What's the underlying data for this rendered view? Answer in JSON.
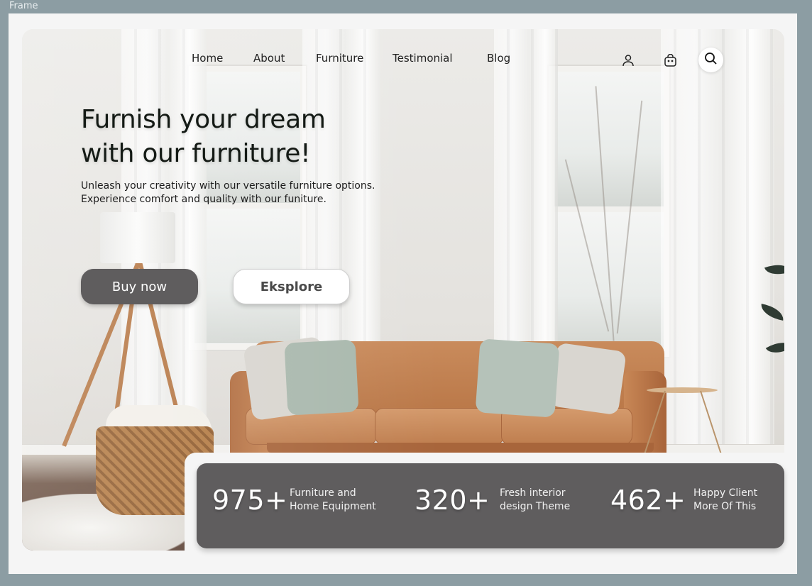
{
  "canvas": {
    "frame_label": "Frame"
  },
  "nav": {
    "links": [
      "Home",
      "About",
      "Furniture",
      "Testimonial",
      "Blog"
    ],
    "icons": [
      "user-icon",
      "shopping-bag-icon",
      "search-icon"
    ]
  },
  "hero": {
    "headline_line1": "Furnish your dream",
    "headline_line2": "with our furniture!",
    "subtext_line1": "Unleash your creativity with our versatile furniture options.",
    "subtext_line2": "Experience comfort and quality with our funiture.",
    "primary_button": "Buy now",
    "secondary_button": "Eksplore"
  },
  "stats": [
    {
      "value": "975+",
      "label_line1": "Furniture and",
      "label_line2": "Home Equipment"
    },
    {
      "value": "320+",
      "label_line1": "Fresh interior",
      "label_line2": "design Theme"
    },
    {
      "value": "462+",
      "label_line1": "Happy Client",
      "label_line2": "More Of This"
    }
  ],
  "colors": {
    "dark_panel": "#5f5d5e",
    "frame_bg": "#8c9da3",
    "card_bg": "#f5f5f5",
    "accent_sofa": "#c98b5c"
  }
}
